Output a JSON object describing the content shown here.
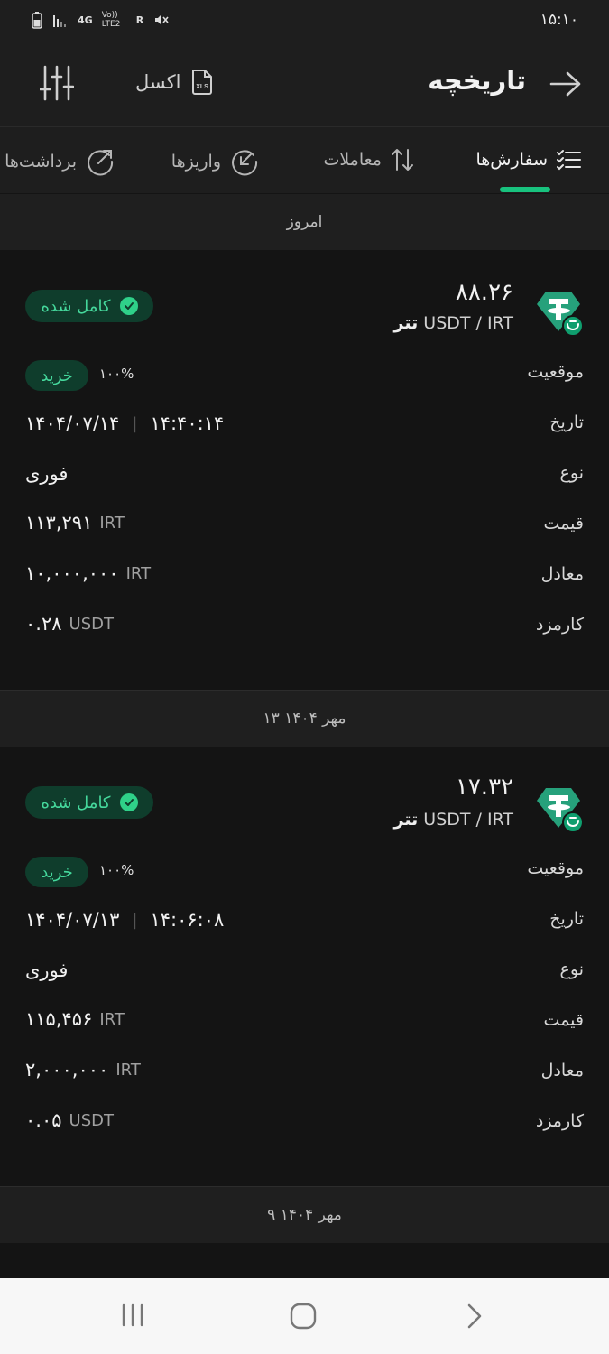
{
  "status": {
    "time": "۱۵:۱۰",
    "net1": "4G",
    "net2": "Vo)) LTE2",
    "roam": "R"
  },
  "header": {
    "title": "تاریخچه",
    "excel_label": "اکسل",
    "excel_icon": "xls-file-icon"
  },
  "tabs": [
    {
      "label": "سفارش‌ها",
      "icon": "list-check-icon",
      "active": true
    },
    {
      "label": "معاملات",
      "icon": "swap-vertical-icon"
    },
    {
      "label": "واریزها",
      "icon": "deposit-arrow-icon"
    },
    {
      "label": "برداشت‌ها",
      "icon": "withdraw-arrow-icon"
    }
  ],
  "groups": [
    {
      "day": "امروز",
      "order": {
        "amount": "۸۸.۲۶",
        "asset": "تتر",
        "pair": "USDT / IRT",
        "status": "کامل شده",
        "side": "خرید",
        "fill": "۱۰۰%",
        "labels": {
          "position": "موقعیت",
          "date": "تاریخ",
          "type": "نوع",
          "price": "قیمت",
          "equivalent": "معادل",
          "fee": "کارمزد"
        },
        "date": "۱۴۰۴/۰۷/۱۴",
        "time": "۱۴:۴۰:۱۴",
        "type": "فوری",
        "price": "۱۱۳,۲۹۱",
        "price_unit": "IRT",
        "equivalent": "۱۰,۰۰۰,۰۰۰",
        "equivalent_unit": "IRT",
        "fee": "۰.۲۸",
        "fee_unit": "USDT"
      }
    },
    {
      "day": "۱۳ مهر ۱۴۰۴",
      "order": {
        "amount": "۱۷.۳۲",
        "asset": "تتر",
        "pair": "USDT / IRT",
        "status": "کامل شده",
        "side": "خرید",
        "fill": "۱۰۰%",
        "labels": {
          "position": "موقعیت",
          "date": "تاریخ",
          "type": "نوع",
          "price": "قیمت",
          "equivalent": "معادل",
          "fee": "کارمزد"
        },
        "date": "۱۴۰۴/۰۷/۱۳",
        "time": "۱۴:۰۶:۰۸",
        "type": "فوری",
        "price": "۱۱۵,۴۵۶",
        "price_unit": "IRT",
        "equivalent": "۲,۰۰۰,۰۰۰",
        "equivalent_unit": "IRT",
        "fee": "۰.۰۵",
        "fee_unit": "USDT"
      }
    },
    {
      "day": "۹ مهر ۱۴۰۴"
    }
  ],
  "colors": {
    "accent": "#18c27e",
    "badge_bg": "#0f3d2c",
    "badge_text": "#45d89c",
    "tether": "#26a17b"
  }
}
